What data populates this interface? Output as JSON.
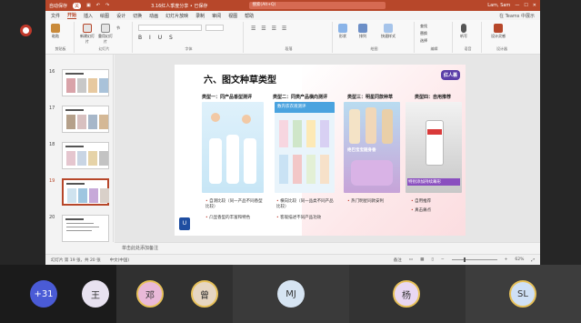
{
  "titlebar": {
    "autosave": "自动保存",
    "autosave_state": "关",
    "file_title": "3.16红人季度分享 • 已保存",
    "search_placeholder": "搜索(Alt+Q)",
    "user": "Lam, Sam"
  },
  "tabs": [
    "文件",
    "开始",
    "插入",
    "绘图",
    "设计",
    "切换",
    "动画",
    "幻灯片放映",
    "录制",
    "审阅",
    "视图",
    "帮助"
  ],
  "teams_label": "在 Teams 中展示",
  "ribbon": {
    "groups": [
      "剪贴板",
      "幻灯片",
      "字体",
      "段落",
      "绘图",
      "编辑",
      "语音",
      "设计器"
    ],
    "buttons": [
      "粘贴",
      "新建幻灯片",
      "重用幻灯片",
      "节",
      "形状",
      "排列",
      "快速样式",
      "查找",
      "替换",
      "选择",
      "听写",
      "设计灵感"
    ]
  },
  "thumbnails": [
    {
      "num": "16",
      "selected": false
    },
    {
      "num": "17",
      "selected": false
    },
    {
      "num": "18",
      "selected": false
    },
    {
      "num": "19",
      "selected": true
    },
    {
      "num": "20",
      "selected": false
    }
  ],
  "slide": {
    "title": "六、图文种草类型",
    "logo": "红人荟",
    "columns": [
      {
        "head": "类型一：同产品香型测评",
        "notes": [
          "自测比较（同一产品不同香型比较）",
          "凸显香型的丰富和特色"
        ]
      },
      {
        "head": "类型二：同类产品横向测评",
        "notes": [
          "横向比较（同一品类不同产品比较）",
          "客观描述不同产品功效"
        ]
      },
      {
        "head": "类型三：明星同款种草",
        "notes": [
          "热门明星同款安利"
        ]
      },
      {
        "head": "类型四：自用推荐",
        "notes": [
          "自用推荐",
          "真击痛点"
        ]
      }
    ],
    "img_captions": [
      "数内衣衣液测评",
      "绝巴宝宝随身香",
      "特别添加持续幕形"
    ]
  },
  "notes_placeholder": "单击此处添加备注",
  "status": {
    "slide_info": "幻灯片 第 19 张，共 20 张",
    "language": "中文(中国)",
    "notes_label": "备注",
    "zoom": "62%"
  },
  "participants": [
    {
      "label": "+31",
      "bg": "#4a5bd6",
      "fg": "#ffffff",
      "ring": false
    },
    {
      "label": "王",
      "bg": "#e8e2f0",
      "fg": "#333333",
      "ring": false
    },
    {
      "label": "邓",
      "bg": "#e9b9d8",
      "fg": "#333333",
      "ring": true
    },
    {
      "label": "曾",
      "bg": "#e6d6c2",
      "fg": "#333333",
      "ring": true
    },
    {
      "label": "MJ",
      "bg": "#d6e4f2",
      "fg": "#333333",
      "ring": false
    },
    {
      "label": "杨",
      "bg": "#e9d8f2",
      "fg": "#333333",
      "ring": true
    },
    {
      "label": "SL",
      "bg": "#cfe0f5",
      "fg": "#333333",
      "ring": true
    }
  ]
}
